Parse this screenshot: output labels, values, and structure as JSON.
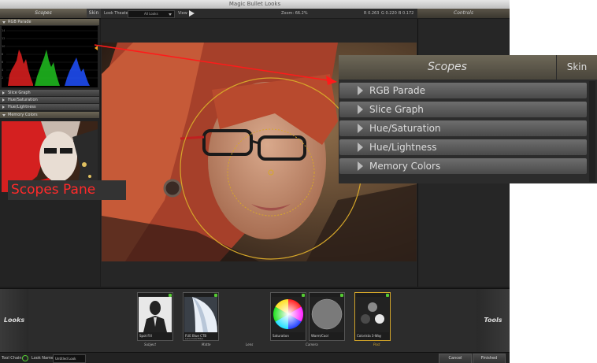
{
  "window": {
    "title": "Magic Bullet Looks"
  },
  "left_header": {
    "scopes_label": "Scopes",
    "skin_label": "Skin"
  },
  "toolbar": {
    "look_theater_label": "Look Theater",
    "look_select_value": "All Looks",
    "view_label": "View",
    "zoom_text": "Zoom: 66.2%",
    "r_value": "R 0.263",
    "g_value": "G 0.220",
    "b_value": "B 0.172"
  },
  "right_header": {
    "controls_label": "Controls"
  },
  "scopes_pane": {
    "items": [
      {
        "label": "RGB Parade",
        "expanded": true
      },
      {
        "label": "Slice Graph",
        "expanded": false
      },
      {
        "label": "Hue/Saturation",
        "expanded": false
      },
      {
        "label": "Hue/Lightness",
        "expanded": false
      },
      {
        "label": "Memory Colors",
        "expanded": true
      }
    ],
    "scope_scale": [
      "14",
      "12",
      "10",
      "8",
      "6",
      "4",
      "2"
    ]
  },
  "annotation": {
    "text": "Scopes Pane",
    "color": "#ff2a2a"
  },
  "zoom_panel": {
    "scopes_label": "Scopes",
    "skin_label": "Skin",
    "items": [
      "RGB Parade",
      "Slice Graph",
      "Hue/Saturation",
      "Hue/Lightness",
      "Memory Colors"
    ]
  },
  "bottom": {
    "looks_label": "Looks",
    "tools_label": "Tools",
    "tools": [
      {
        "label": "Spot Fill",
        "sub": ""
      },
      {
        "label": "FUE Blue CTB",
        "sub": "Lens ColorFilter"
      },
      {
        "label": "Saturation",
        "sub": ""
      },
      {
        "label": "Warm/Cool",
        "sub": ""
      },
      {
        "label": "Colorista 3-Way",
        "sub": ""
      }
    ],
    "categories": [
      "Subject",
      "Matte",
      "Lens",
      "Camera",
      "Post"
    ]
  },
  "status": {
    "tool_chain_label": "Tool Chain:",
    "look_name_label": "Look Name:",
    "look_name_value": "Untitled Look",
    "cancel_label": "Cancel",
    "finished_label": "Finished"
  },
  "colors": {
    "accent_gold": "#d6a72a",
    "annotation_red": "#ff2a2a",
    "panel_bg": "#1c1c1c"
  }
}
